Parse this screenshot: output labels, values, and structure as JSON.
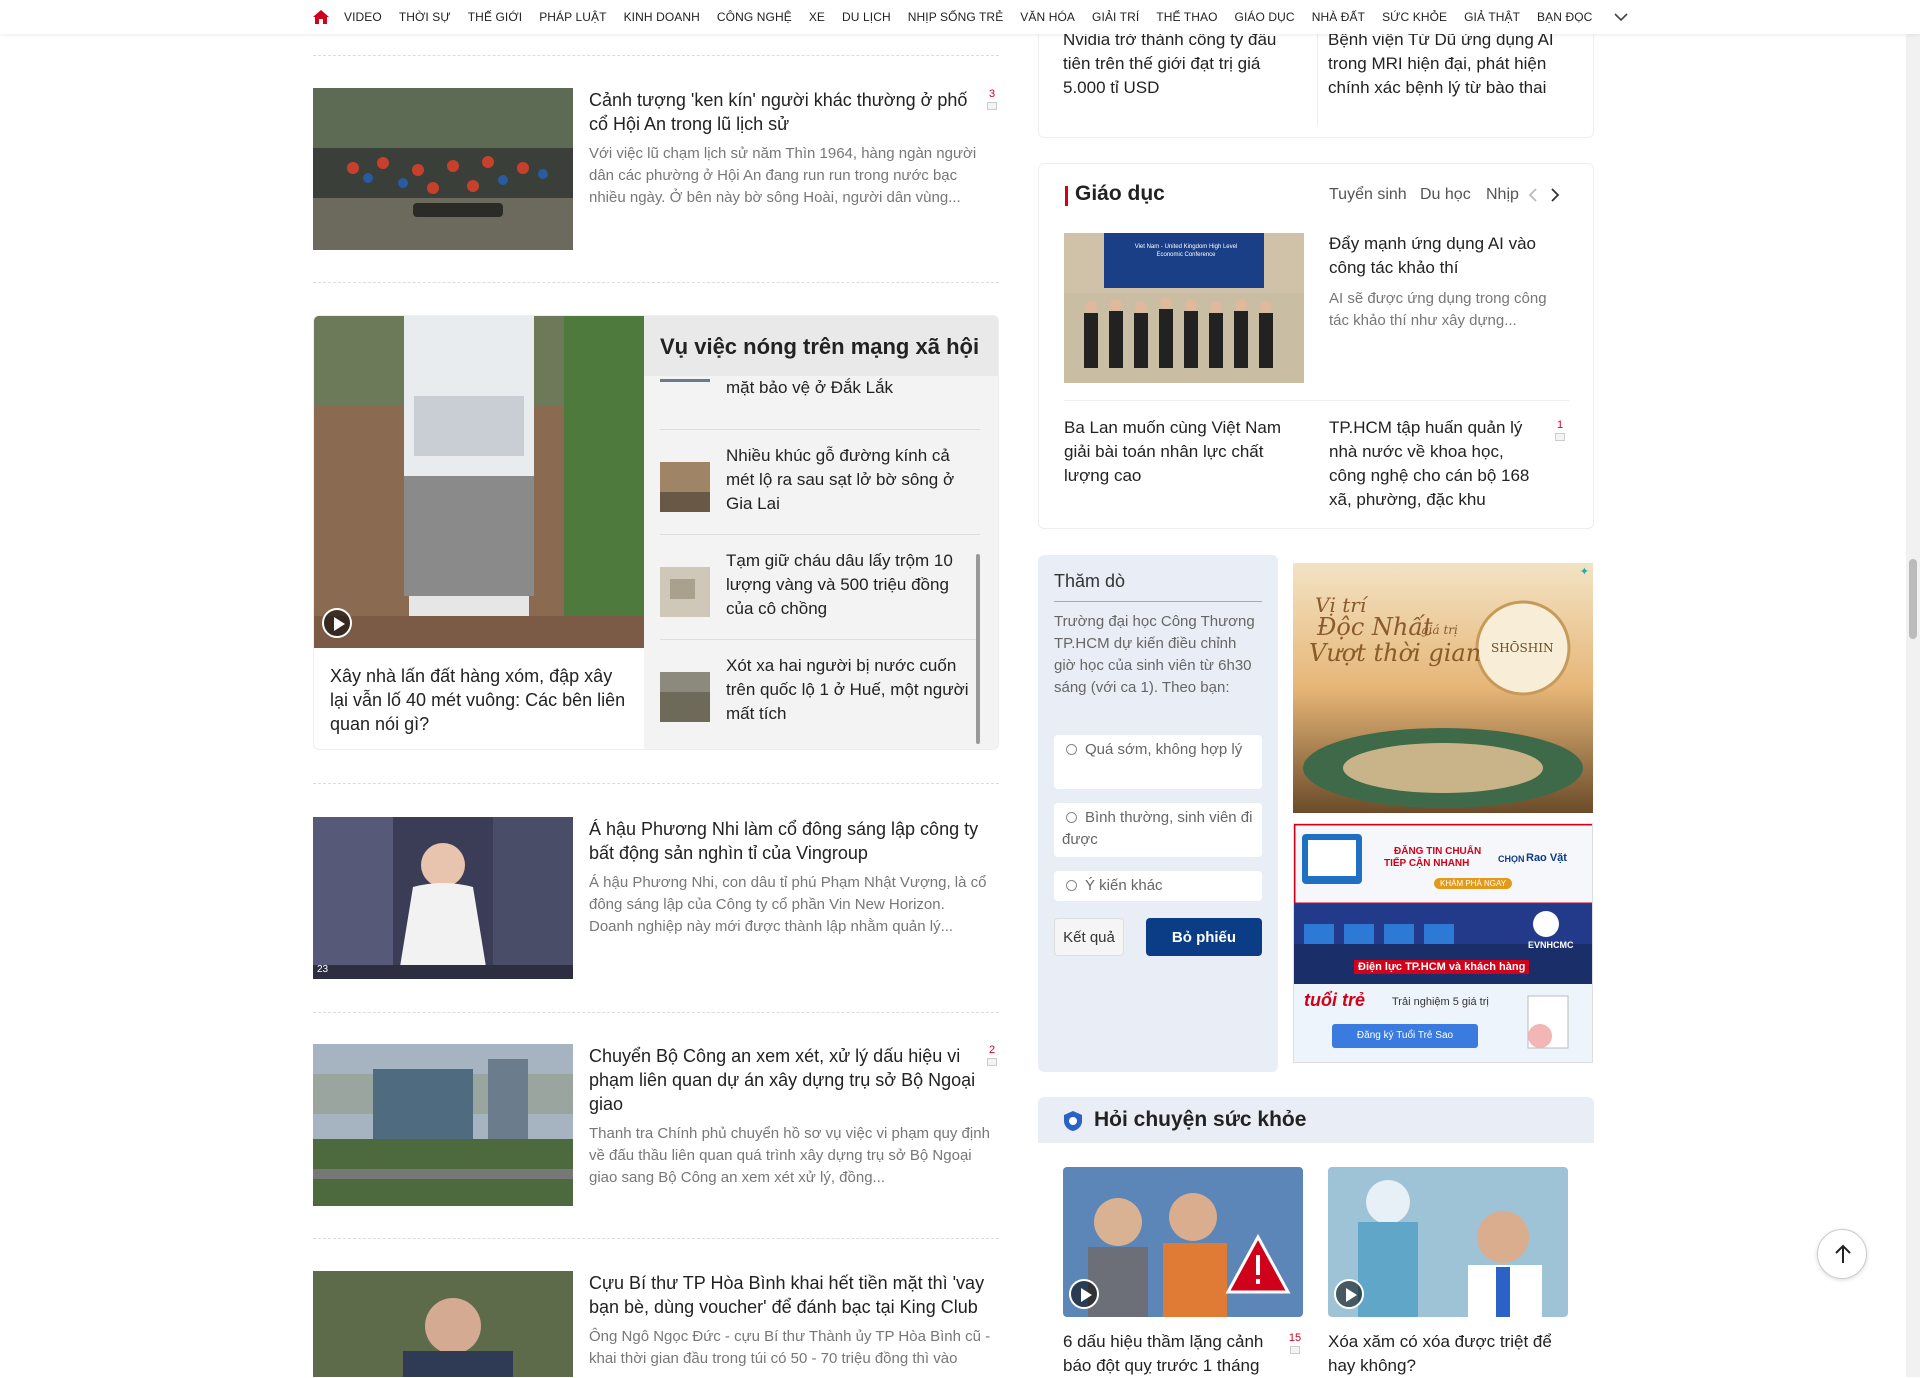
{
  "nav": {
    "items": [
      "VIDEO",
      "THỜI SỰ",
      "THẾ GIỚI",
      "PHÁP LUẬT",
      "KINH DOANH",
      "CÔNG NGHỆ",
      "XE",
      "DU LỊCH",
      "NHỊP SỐNG TRẺ",
      "VĂN HÓA",
      "GIẢI TRÍ",
      "THỂ THAO",
      "GIÁO DỤC",
      "NHÀ ĐẤT",
      "SỨC KHỎE",
      "GIẢ THẬT",
      "BẠN ĐỌC"
    ]
  },
  "articles": [
    {
      "title": "Cảnh tượng 'ken kín' người khác thường ở phố cổ Hội An trong lũ lịch sử",
      "sapo": "Với việc lũ chạm lịch sử năm Thìn 1964, hàng ngàn người dân các phường ở Hội An đang run run trong nước bạc nhiều ngày. Ở bên này bờ sông Hoài, người dân vùng...",
      "comments": "3"
    },
    {
      "title": "Á hậu Phương Nhi làm cổ đông sáng lập công ty bất động sản nghìn tỉ của Vingroup",
      "sapo": "Á hậu Phương Nhi, con dâu tỉ phú Phạm Nhật Vượng, là cổ đông sáng lập của Công ty cổ phần Vin New Horizon. Doanh nghiệp này mới được thành lập nhằm quản lý...",
      "comments": "",
      "thumb_label": "23"
    },
    {
      "title": "Chuyển Bộ Công an xem xét, xử lý dấu hiệu vi phạm liên quan dự án xây dựng trụ sở Bộ Ngoại giao",
      "sapo": "Thanh tra Chính phủ chuyển hồ sơ vụ việc vi phạm quy định về đấu thầu liên quan quá trình xây dựng trụ sở Bộ Ngoại giao sang Bộ Công an xem xét xử lý, đồng...",
      "comments": "2"
    },
    {
      "title": "Cựu Bí thư TP Hòa Bình khai hết tiền mặt thì 'vay bạn bè, dùng voucher' để đánh bạc tại King Club",
      "sapo": "Ông Ngô Ngọc Đức - cựu Bí thư Thành ủy TP Hòa Bình cũ - khai thời gian đầu trong túi có 50 - 70 triệu đồng thì vào",
      "comments": ""
    }
  ],
  "social": {
    "heading": "Vụ việc nóng trên mạng xã hội",
    "video_title": "Xây nhà lấn đất hàng xóm, đập xây lại vẫn lố 40 mét vuông: Các bên liên quan nói gì?",
    "items": [
      "mặt bảo vệ ở Đắk Lắk",
      "Nhiều khúc gỗ đường kính cả mét lộ ra sau sạt lở bờ sông ở Gia Lai",
      "Tạm giữ cháu dâu lấy trộm 10 lượng vàng và 500 triệu đồng của cô chồng",
      "Xót xa hai người bị nước cuốn trên quốc lộ 1 ở Huế, một người mất tích"
    ]
  },
  "top_right": {
    "left_title": "Nvidia trở thành công ty đầu tiên trên thế giới đạt trị giá 5.000 tỉ USD",
    "right_title": "Bệnh viện Từ Dũ ứng dụng AI trong MRI hiện đại, phát hiện chính xác bệnh lý từ bào thai"
  },
  "education": {
    "title": "Giáo dục",
    "tabs": [
      "Tuyển sinh",
      "Du học",
      "Nhịp"
    ],
    "lead_title": "Đẩy mạnh ứng dụng AI vào công tác khảo thí",
    "lead_sapo": "AI sẽ được ứng dụng trong công tác khảo thí như xây dựng...",
    "item1": "Ba Lan muốn cùng Việt Nam giải bài toán nhân lực chất lượng cao",
    "item2": "TP.HCM tập huấn quản lý nhà nước về khoa học, công nghệ cho cán bộ 168 xã, phường, đặc khu",
    "item2_comments": "1",
    "banner_text": "Viet Nam - United Kingdom High Level Economic Conference"
  },
  "poll": {
    "title": "Thăm dò",
    "question": "Trường đại học Công Thương TP.HCM dự kiến điều chỉnh giờ học của sinh viên từ 6h30 sáng (với ca 1). Theo bạn:",
    "options": [
      "Quá sớm, không hợp lý",
      "Bình thường, sinh viên đi được",
      "Ý kiến khác"
    ],
    "result_label": "Kết quả",
    "vote_label": "Bỏ phiếu"
  },
  "ads": {
    "ad1_line1": "Vị trí",
    "ad1_line2": "Độc Nhất",
    "ad1_line3": "giá trị",
    "ad1_line4": "Vượt thời gian",
    "ad1_brand": "SHŌSHIN",
    "ad2_line1": "ĐĂNG TIN CHUẨN",
    "ad2_line2": "TIẾP CẬN NHANH",
    "ad2_cta": "KHÁM PHÁ NGAY",
    "ad2_brand": "CHỌN",
    "ad2_brand2": "Rao Vặt",
    "ad3_text": "Điện lực TP.HCM và khách hàng",
    "ad3_brand": "EVNHCMC",
    "ad4_logo": "tuổi trẻ",
    "ad4_text": "Trải nghiệm 5 giá trị",
    "ad4_cta": "Đăng ký Tuổi Trẻ Sao"
  },
  "health": {
    "title": "Hỏi chuyện sức khỏe",
    "card1_title": "6 dấu hiệu thầm lặng cảnh báo đột quỵ trước 1 tháng",
    "card1_comments": "15",
    "card2_title": "Xóa xăm có xóa được triệt để hay không?"
  },
  "colors": {
    "accent_red": "#d0021b",
    "vote_blue": "#0b3c86",
    "poll_bg": "#e9eef6"
  }
}
